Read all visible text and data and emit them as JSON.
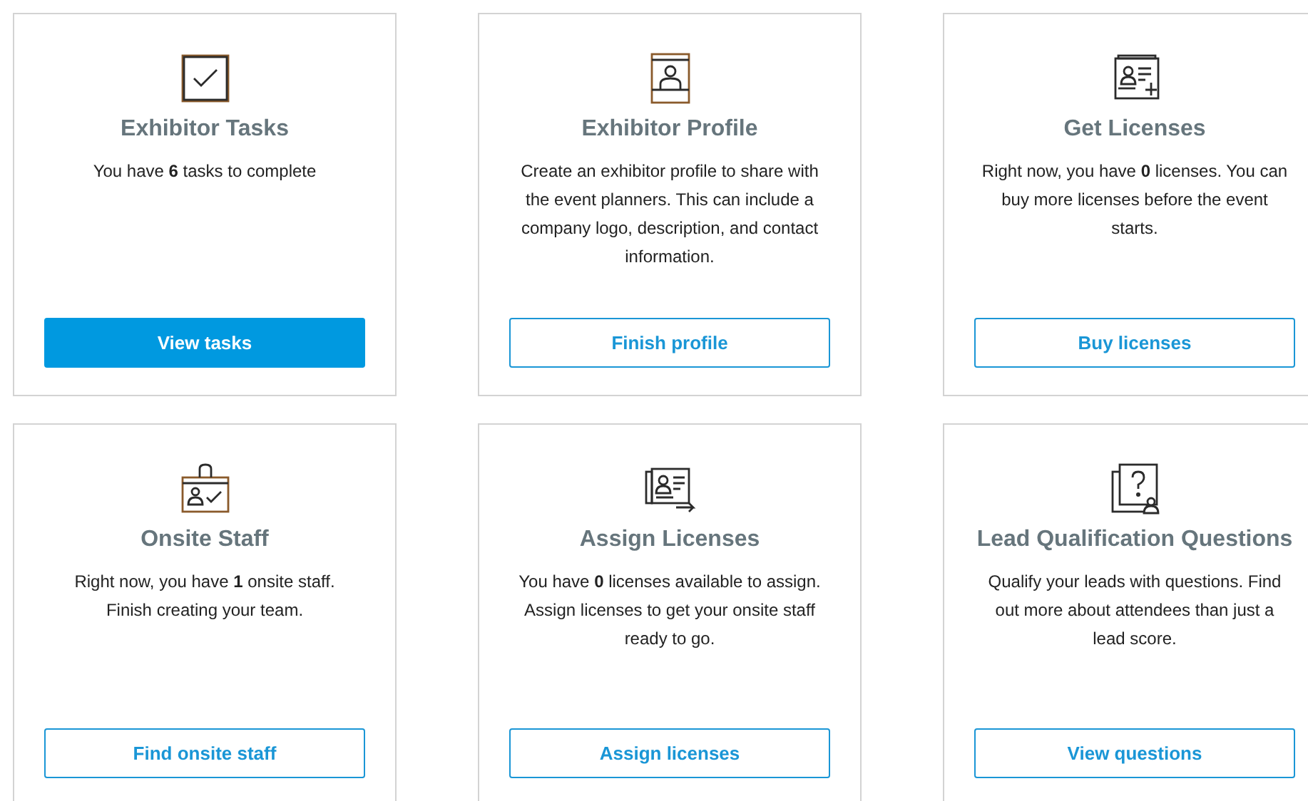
{
  "cards": [
    {
      "title": "Exhibitor Tasks",
      "text": "You have **6** tasks to complete",
      "button": {
        "label": "View tasks",
        "kind": "primary"
      }
    },
    {
      "title": "Exhibitor Profile",
      "text": "Create an exhibitor profile to share with the event planners. This can include a company logo, description, and contact information.",
      "button": {
        "label": "Finish profile",
        "kind": "secondary"
      }
    },
    {
      "title": "Get Licenses",
      "text": "Right now, you have **0** licenses. You can buy more licenses before the event starts.",
      "button": {
        "label": "Buy licenses",
        "kind": "secondary"
      }
    },
    {
      "title": "Onsite Staff",
      "text": "Right now, you have **1** onsite staff. Finish creating your team.",
      "button": {
        "label": "Find onsite staff",
        "kind": "secondary"
      }
    },
    {
      "title": "Assign Licenses",
      "text": "You have **0** licenses available to assign. Assign licenses to get your onsite staff ready to go.",
      "button": {
        "label": "Assign licenses",
        "kind": "secondary"
      }
    },
    {
      "title": "Lead Qualification Questions",
      "text": "Qualify your leads with questions. Find out more about attendees than just a lead score.",
      "button": {
        "label": "View questions",
        "kind": "secondary"
      }
    }
  ]
}
